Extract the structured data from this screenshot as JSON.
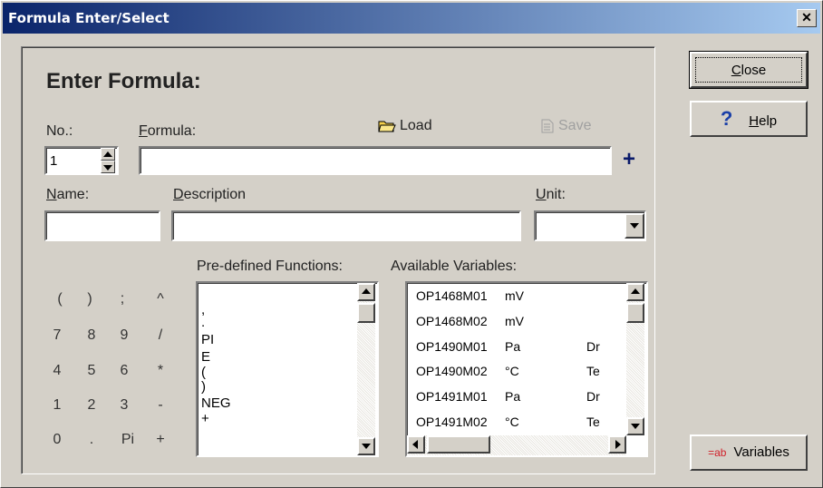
{
  "window": {
    "title": "Formula Enter/Select",
    "close_glyph": "✕"
  },
  "heading": "Enter Formula:",
  "labels": {
    "no": "No.:",
    "formula_first": "F",
    "formula_rest": "ormula:",
    "name_first": "N",
    "name_rest": "ame:",
    "description_first": "D",
    "description_rest": "escription",
    "unit_first": "U",
    "unit_rest": "nit:",
    "predefined": "Pre-defined Functions:",
    "available": "Available Variables:"
  },
  "toolbar": {
    "load": "Load",
    "save": "Save",
    "add": "+"
  },
  "fields": {
    "no_value": "1",
    "formula_value": "",
    "name_value": "",
    "description_value": "",
    "unit_value": ""
  },
  "keypad": [
    [
      "(",
      ")",
      ";",
      "^"
    ],
    [
      "7",
      "8",
      "9",
      "/"
    ],
    [
      "4",
      "5",
      "6",
      "*"
    ],
    [
      "1",
      "2",
      "3",
      "-"
    ],
    [
      "0",
      ".",
      "Pi",
      "+"
    ]
  ],
  "functions": [
    ",",
    ".",
    "PI",
    "E",
    "(",
    ")",
    "NEG",
    "+"
  ],
  "variables": [
    {
      "name": "OP1468M01",
      "unit": "mV",
      "desc": ""
    },
    {
      "name": "OP1468M02",
      "unit": "mV",
      "desc": ""
    },
    {
      "name": "OP1490M01",
      "unit": "Pa",
      "desc": "Dr"
    },
    {
      "name": "OP1490M02",
      "unit": "°C",
      "desc": "Te"
    },
    {
      "name": "OP1491M01",
      "unit": "Pa",
      "desc": "Dr"
    },
    {
      "name": "OP1491M02",
      "unit": "°C",
      "desc": "Te"
    }
  ],
  "buttons": {
    "close_first": "C",
    "close_rest": "lose",
    "help_first": "H",
    "help_rest": "elp",
    "help_icon": "?",
    "variables_icon": "=ab",
    "variables": "Variables"
  }
}
